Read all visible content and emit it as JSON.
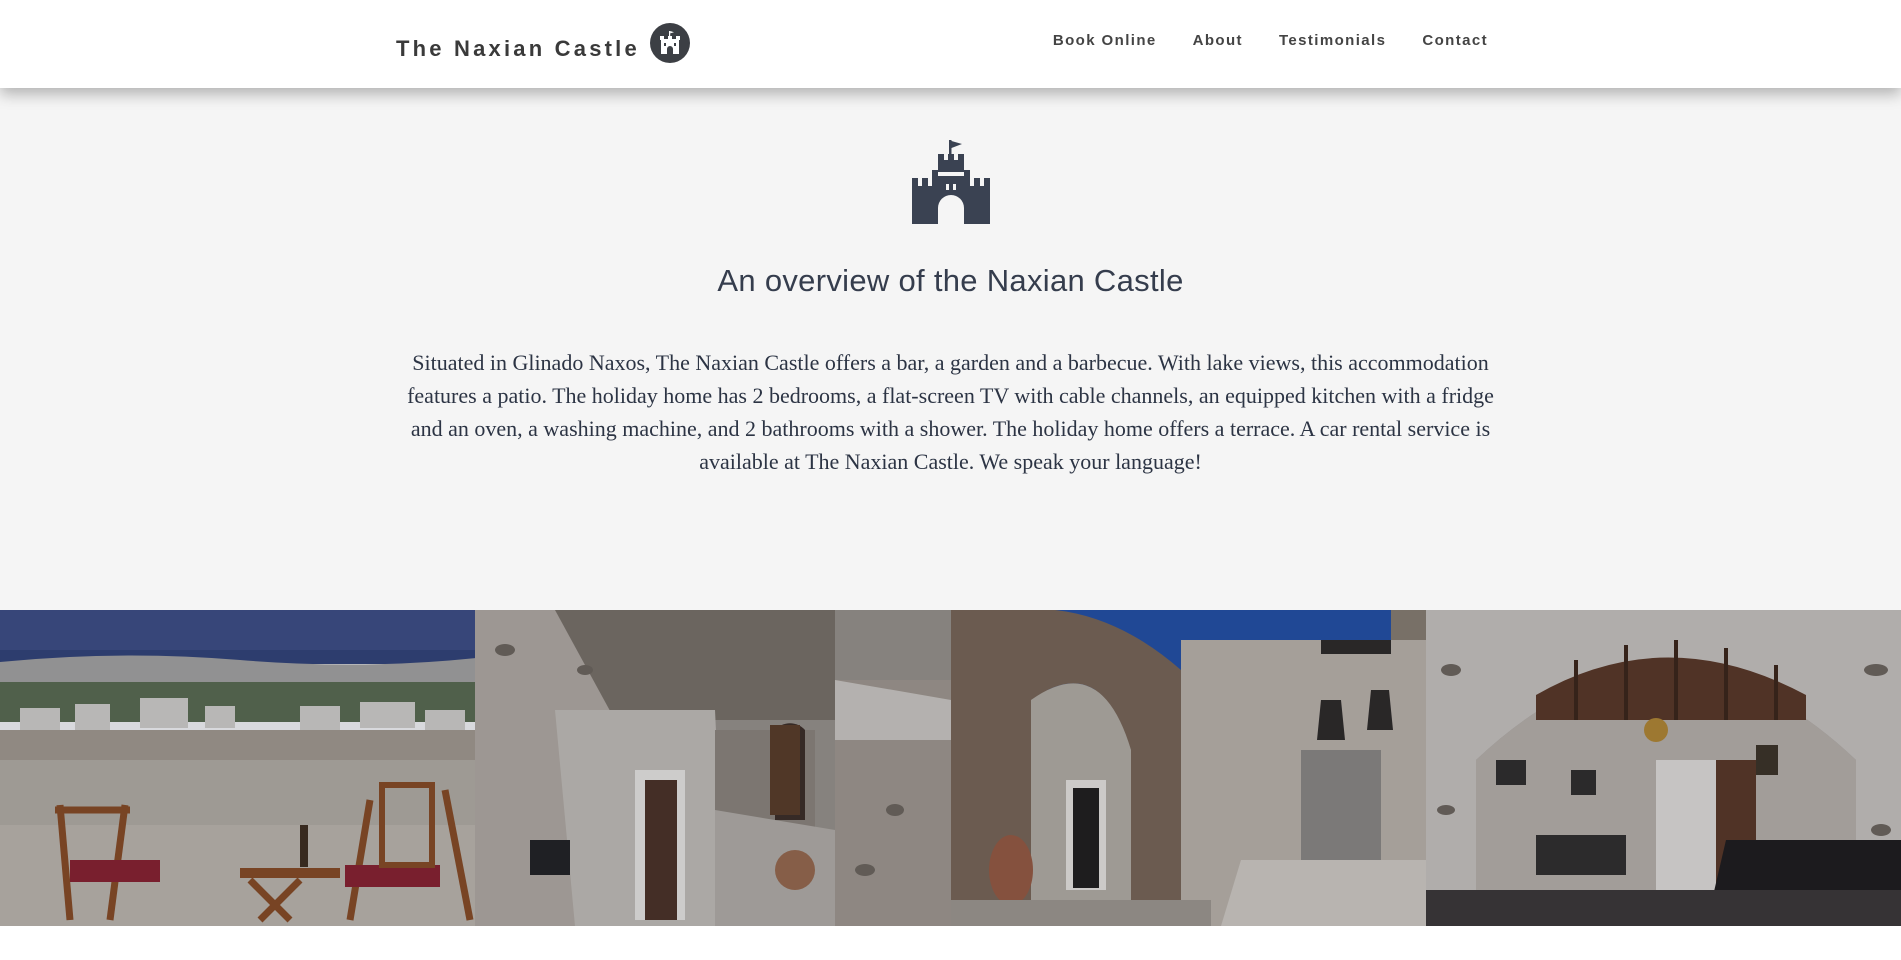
{
  "header": {
    "brand_name": "The Naxian Castle",
    "brand_logo_icon": "castle-icon",
    "nav": [
      {
        "label": "Book Online"
      },
      {
        "label": "About"
      },
      {
        "label": "Testimonials"
      },
      {
        "label": "Contact"
      }
    ]
  },
  "overview": {
    "icon": "castle-icon",
    "title": "An overview of the Naxian Castle",
    "description": "Situated in Glinado Naxos, The Naxian Castle offers a bar, a garden and a barbecue. With lake views, this accommodation features a patio. The holiday home has 2 bedrooms, a flat-screen TV with cable channels, an equipped kitchen with a fridge and an oven, a washing machine, and 2 bathrooms with a shower. The holiday home offers a terrace. A car rental service is available at The Naxian Castle. We speak your language!"
  },
  "gallery": {
    "photos": [
      {
        "subject": "terrace with chairs and sea view"
      },
      {
        "subject": "stone courtyard with wooden door"
      },
      {
        "subject": "stone archway with lanterns"
      },
      {
        "subject": "interior arched room with bar"
      }
    ]
  },
  "colors": {
    "header_bg": "#ffffff",
    "section_bg": "#f5f5f5",
    "text_dark": "#353d4d",
    "icon_dark": "#3a4252"
  }
}
